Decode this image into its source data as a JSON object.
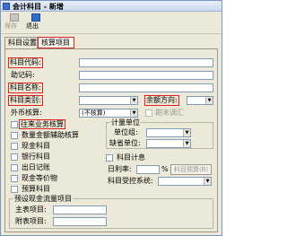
{
  "window": {
    "title": "会计科目 - 新增"
  },
  "toolbar": {
    "save_label": "保存",
    "exit_label": "退出"
  },
  "tabs": [
    {
      "label": "科目设置"
    },
    {
      "label": "核算项目"
    }
  ],
  "form": {
    "code_label": "科目代码:",
    "mnemonic_label": "助记码:",
    "name_label": "科目名称:",
    "category_label": "科目类别:",
    "direction_label": "余额方向:",
    "currency_label": "外币核算:",
    "currency_value": "(不核算)",
    "revalue_label": "期末调汇"
  },
  "checkboxes": [
    {
      "label": "往来业务核算"
    },
    {
      "label": "数量金额辅助核算"
    },
    {
      "label": "现金科目"
    },
    {
      "label": "银行科目"
    },
    {
      "label": "出日记账"
    },
    {
      "label": "现金等价物"
    },
    {
      "label": "预算科目"
    }
  ],
  "measure": {
    "group_title": "计量单位",
    "unit_group_label": "单位组:",
    "default_unit_label": "缺省单位:"
  },
  "interest": {
    "check_label": "科目计息",
    "rate_label": "日利率:",
    "rate_unit": "%",
    "control_label": "科目受控系统:",
    "button_label": "科目预算(B)"
  },
  "cashflow": {
    "group_title": "预设现金流量项目",
    "main_label": "主表项目:",
    "sub_label": "附表项目:"
  }
}
